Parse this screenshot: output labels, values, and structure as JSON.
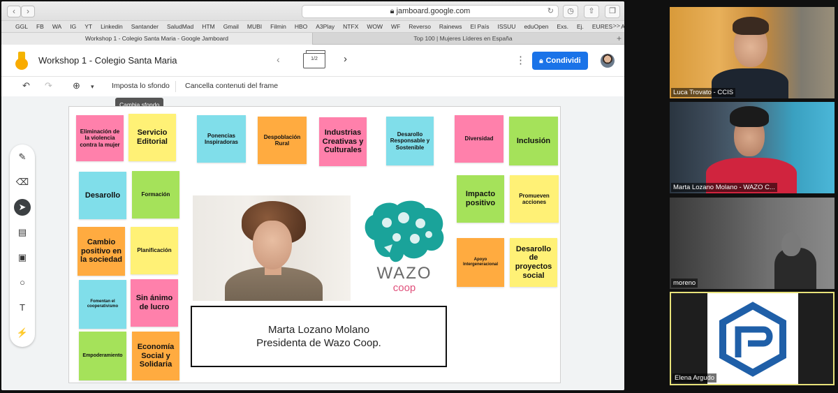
{
  "browser": {
    "url": "jamboard.google.com",
    "bookmarks": [
      "GGL",
      "FB",
      "WA",
      "IG",
      "YT",
      "Linkedin",
      "Santander",
      "SaludMad",
      "HTM",
      "Gmail",
      "MUBI",
      "Filmin",
      "HBO",
      "A3Play",
      "NTFX",
      "WOW",
      "WF",
      "Reverso",
      "Rainews",
      "El País",
      "ISSUU",
      "eduOpen",
      "Exs.",
      "Ej.",
      "EURES",
      "Alma"
    ],
    "bookmarks_more": ">>",
    "tabs": [
      {
        "label": "Workshop 1 - Colegio Santa Maria - Google Jamboard",
        "active": true
      },
      {
        "label": "Top 100 | Mujeres Líderes en España",
        "active": false
      }
    ]
  },
  "app": {
    "title": "Workshop 1 - Colegio Santa Maria",
    "frame_counter": "1/2",
    "share_label": "Condividi",
    "toolbar": {
      "set_background": "Imposta lo sfondo",
      "clear_frame": "Cancella contenuti del frame",
      "tooltip": "Cambia sfondo"
    }
  },
  "notes": [
    {
      "text": "Eliminación de la violencia contra la mujer",
      "color": "pink"
    },
    {
      "text": "Servicio Editorial",
      "color": "yellow"
    },
    {
      "text": "Ponencias Inspiradoras",
      "color": "blue"
    },
    {
      "text": "Despoblación Rural",
      "color": "orange"
    },
    {
      "text": "Industrias Creativas y Culturales",
      "color": "pink"
    },
    {
      "text": "Desarollo Responsable y Sostenible",
      "color": "blue"
    },
    {
      "text": "Diversidad",
      "color": "pink"
    },
    {
      "text": "Inclusión",
      "color": "green"
    },
    {
      "text": "Desarollo",
      "color": "blue"
    },
    {
      "text": "Formación",
      "color": "green"
    },
    {
      "text": "Impacto positivo",
      "color": "green"
    },
    {
      "text": "Promueven acciones",
      "color": "yellow"
    },
    {
      "text": "Cambio positivo en la sociedad",
      "color": "orange"
    },
    {
      "text": "Planificación",
      "color": "yellow"
    },
    {
      "text": "Apoyo Intergeneracional",
      "color": "orange"
    },
    {
      "text": "Desarollo de proyectos social",
      "color": "yellow"
    },
    {
      "text": "Fomentan el cooperativismo",
      "color": "blue"
    },
    {
      "text": "Sin ánimo de lucro",
      "color": "pink"
    },
    {
      "text": "Empoderamiento",
      "color": "green"
    },
    {
      "text": "Economía Social y Solidaria",
      "color": "orange"
    }
  ],
  "caption": {
    "line1": "Marta Lozano Molano",
    "line2": "Presidenta de Wazo Coop."
  },
  "wazo_logo": {
    "word": "WAZO",
    "sub": "coop"
  },
  "participants": [
    {
      "name": "Luca Trovato - CCIS"
    },
    {
      "name": "Marta Lozano Molano - WAZO C..."
    },
    {
      "name": "moreno"
    },
    {
      "name": "Elena Argudo"
    }
  ],
  "colors": {
    "share_blue": "#1a73e8",
    "pink": "#ff80ab",
    "yellow": "#fff176",
    "blue": "#80deea",
    "orange": "#ffab40",
    "green": "#a5e25a",
    "wazo_teal": "#1aa39a",
    "active_speaker_border": "#e8e27a"
  }
}
